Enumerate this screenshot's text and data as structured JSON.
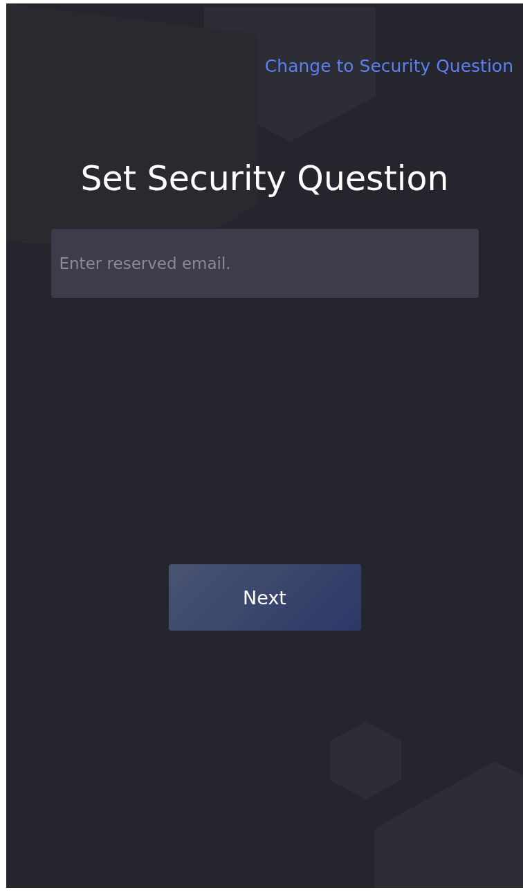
{
  "header": {
    "link": "Change to Security Question"
  },
  "title": "Set Security Question",
  "email_field": {
    "placeholder": "Enter reserved email."
  },
  "buttons": [
    {
      "label": "Next"
    }
  ]
}
